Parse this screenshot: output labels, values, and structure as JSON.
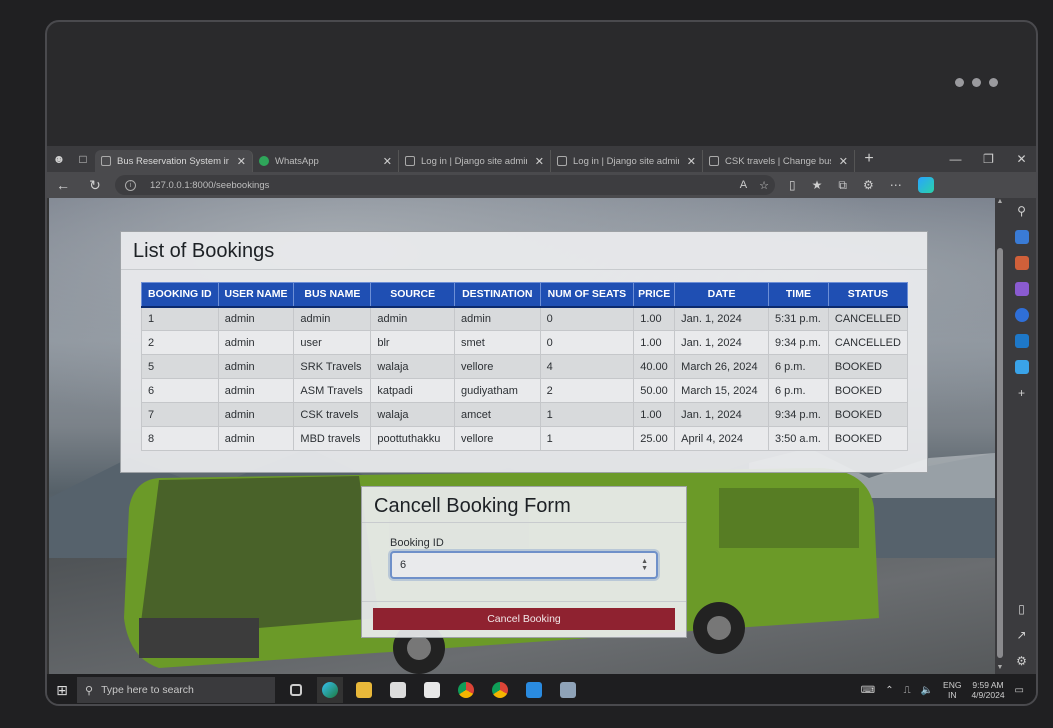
{
  "browser": {
    "tabs": [
      {
        "title": "Bus Reservation System in D",
        "active": true
      },
      {
        "title": "WhatsApp",
        "active": false
      },
      {
        "title": "Log in | Django site admin",
        "active": false
      },
      {
        "title": "Log in | Django site admin",
        "active": false
      },
      {
        "title": "CSK travels | Change bus | D",
        "active": false
      }
    ],
    "url": "127.0.0.1:8000/seebookings"
  },
  "bookings": {
    "title": "List of Bookings",
    "columns": [
      "BOOKING ID",
      "USER NAME",
      "BUS NAME",
      "SOURCE",
      "DESTINATION",
      "NUM OF SEATS",
      "PRICE",
      "DATE",
      "TIME",
      "STATUS"
    ],
    "rows": [
      [
        "1",
        "admin",
        "admin",
        "admin",
        "admin",
        "0",
        "1.00",
        "Jan. 1, 2024",
        "5:31 p.m.",
        "CANCELLED"
      ],
      [
        "2",
        "admin",
        "user",
        "blr",
        "smet",
        "0",
        "1.00",
        "Jan. 1, 2024",
        "9:34 p.m.",
        "CANCELLED"
      ],
      [
        "5",
        "admin",
        "SRK Travels",
        "walaja",
        "vellore",
        "4",
        "40.00",
        "March 26, 2024",
        "6 p.m.",
        "BOOKED"
      ],
      [
        "6",
        "admin",
        "ASM Travels",
        "katpadi",
        "gudiyatham",
        "2",
        "50.00",
        "March 15, 2024",
        "6 p.m.",
        "BOOKED"
      ],
      [
        "7",
        "admin",
        "CSK travels",
        "walaja",
        "amcet",
        "1",
        "1.00",
        "Jan. 1, 2024",
        "9:34 p.m.",
        "BOOKED"
      ],
      [
        "8",
        "admin",
        "MBD travels",
        "poottuthakku",
        "vellore",
        "1",
        "25.00",
        "April 4, 2024",
        "3:50 a.m.",
        "BOOKED"
      ]
    ]
  },
  "cancel_form": {
    "title": "Cancell Booking Form",
    "field_label": "Booking ID",
    "field_value": "6",
    "button_label": "Cancel Booking"
  },
  "taskbar": {
    "search_placeholder": "Type here to search",
    "lang_line1": "ENG",
    "lang_line2": "IN",
    "time": "9:59 AM",
    "date": "4/9/2024"
  },
  "colors": {
    "table_header": "#1f4fb3",
    "cancel_button": "#8f2230"
  }
}
